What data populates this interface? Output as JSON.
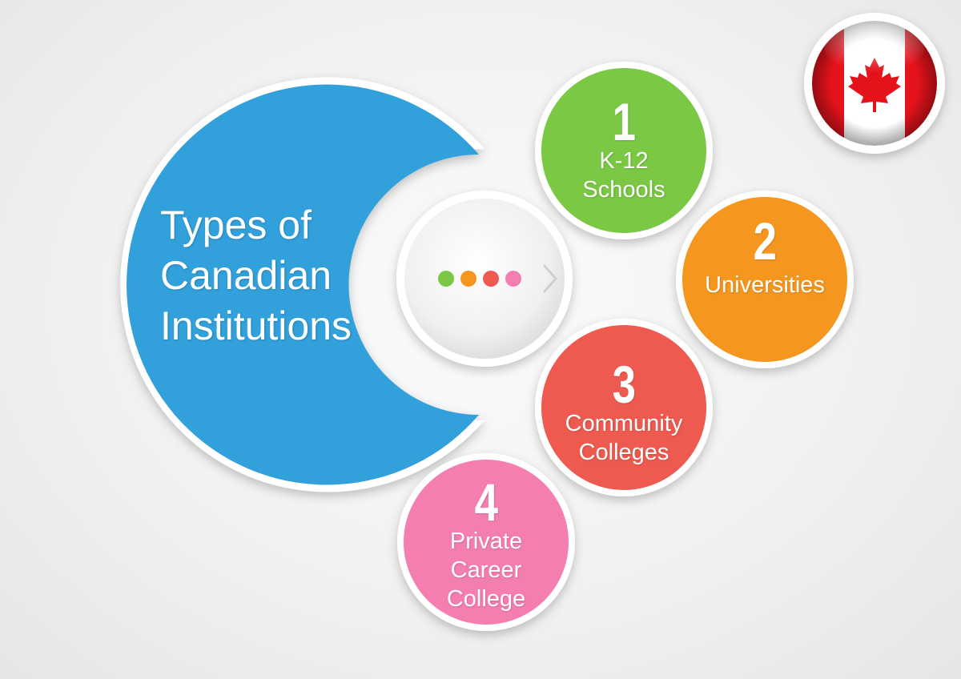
{
  "title_lines": [
    "Types of",
    "Canadian",
    "Institutions"
  ],
  "colors": {
    "main": "#33a0db",
    "green": "#7ac843",
    "orange": "#f5961f",
    "red": "#ef5a50",
    "pink": "#f57eb1",
    "flag_red": "#e3121b"
  },
  "items": [
    {
      "number": "1",
      "lines": [
        "K-12",
        "Schools"
      ],
      "color": "#7ac843"
    },
    {
      "number": "2",
      "lines": [
        "Universities"
      ],
      "color": "#f5961f"
    },
    {
      "number": "3",
      "lines": [
        "Community",
        "Colleges"
      ],
      "color": "#ef5a50"
    },
    {
      "number": "4",
      "lines": [
        "Private",
        "Career",
        "College"
      ],
      "color": "#f57eb1"
    }
  ],
  "hub": {
    "dots": [
      "#7ac843",
      "#f5961f",
      "#ef5a50",
      "#f57eb1"
    ],
    "arrow_icon": "chevron-right-icon"
  },
  "flag_icon": "canada-flag-icon"
}
